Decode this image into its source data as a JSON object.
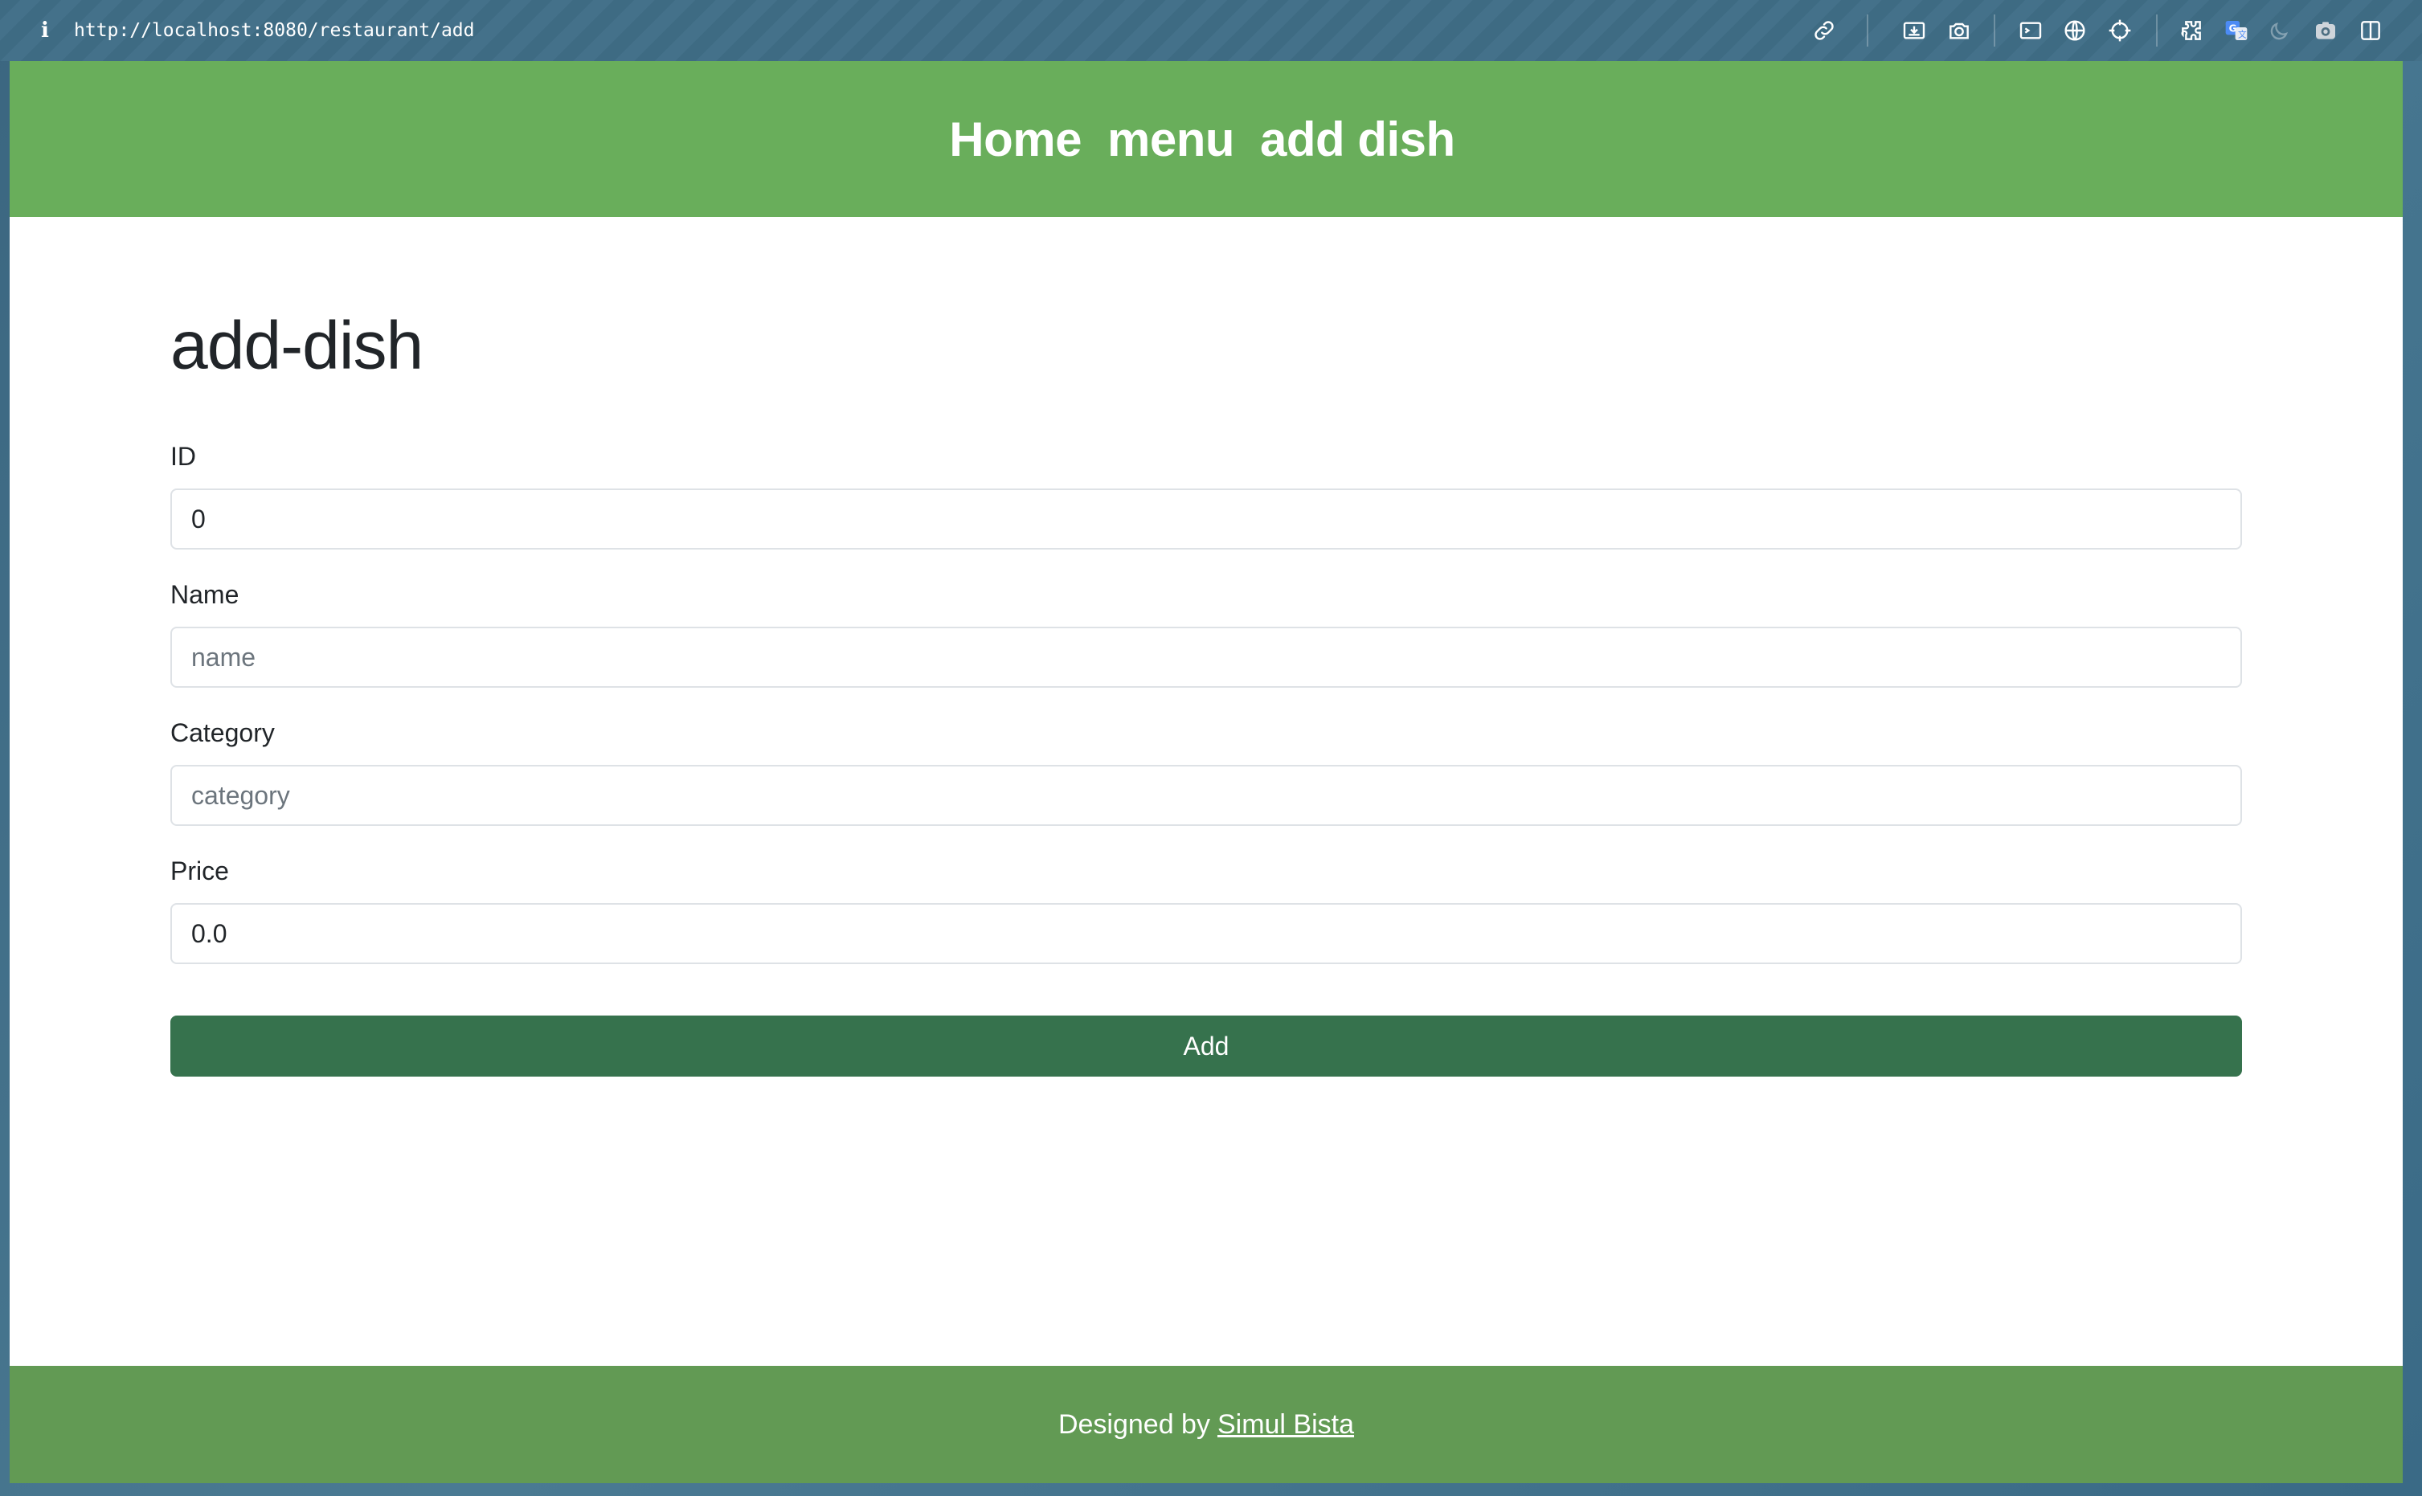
{
  "browser": {
    "url": "http://localhost:8080/restaurant/add",
    "toolbar_icons": [
      "link-icon",
      "save-page-icon",
      "camera-icon",
      "terminal-icon",
      "globe-icon",
      "crosshair-icon",
      "extensions-icon",
      "translate-icon",
      "moon-icon",
      "screenshot-icon",
      "sidebar-icon"
    ]
  },
  "header": {
    "nav": [
      "Home",
      "menu",
      "add dish"
    ],
    "background_color": "#69ae5b"
  },
  "form": {
    "title": "add-dish",
    "fields": [
      {
        "label": "ID",
        "value": "0",
        "placeholder": ""
      },
      {
        "label": "Name",
        "value": "",
        "placeholder": "name"
      },
      {
        "label": "Category",
        "value": "",
        "placeholder": "category"
      },
      {
        "label": "Price",
        "value": "0.0",
        "placeholder": ""
      }
    ],
    "submit_label": "Add",
    "submit_color": "#36724d"
  },
  "footer": {
    "text": "Designed by",
    "author": "Simul Bista",
    "background_color": "#629a54"
  }
}
